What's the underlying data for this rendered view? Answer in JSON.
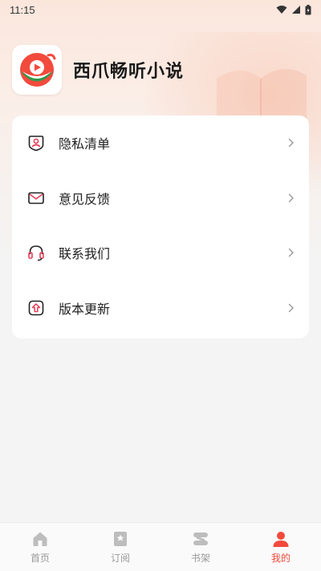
{
  "status_bar": {
    "time": "11:15"
  },
  "app": {
    "name": "西爪畅听小说"
  },
  "menu": {
    "items": [
      {
        "label": "隐私清单",
        "icon": "privacy-list-icon"
      },
      {
        "label": "意见反馈",
        "icon": "mail-icon"
      },
      {
        "label": "联系我们",
        "icon": "headset-icon"
      },
      {
        "label": "版本更新",
        "icon": "upgrade-icon"
      }
    ]
  },
  "tabs": [
    {
      "label": "首页",
      "icon": "home-icon",
      "active": false
    },
    {
      "label": "订阅",
      "icon": "bookmark-icon",
      "active": false
    },
    {
      "label": "书架",
      "icon": "bookshelf-icon",
      "active": false
    },
    {
      "label": "我的",
      "icon": "user-icon",
      "active": true
    }
  ],
  "colors": {
    "accent": "#f24a3c",
    "icon_stroke": "#e8405a",
    "tab_inactive": "#9a9a9a"
  }
}
